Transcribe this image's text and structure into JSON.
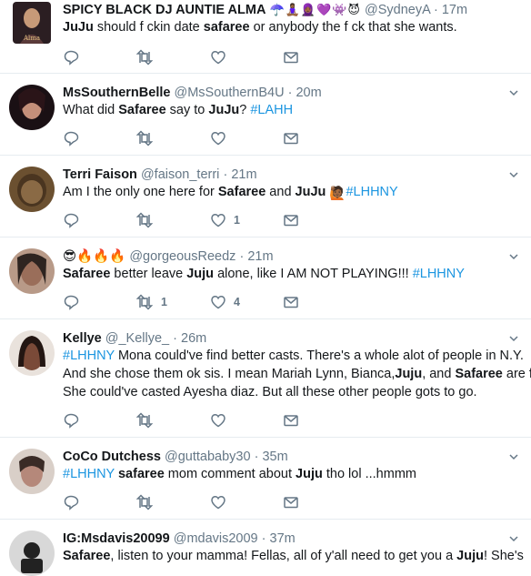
{
  "tweets": [
    {
      "name": "SPICY BLACK DJ AUNTIE ALMA",
      "name_emojis": "☂️🧘🏾‍♀️🧕🏾💜👾😈",
      "handle": "@SydneyA",
      "sep": "·",
      "time": "17m",
      "text": {
        "a": "JuJu",
        "b": " should f  ckin date ",
        "c": "safaree",
        "d": " or anybody the f  ck that she wants."
      },
      "counts": {
        "reply": "",
        "retweet": "",
        "like": ""
      },
      "avatar_colors": [
        "#3b2a2a",
        "#d8b48c"
      ]
    },
    {
      "name": "MsSouthernBelle",
      "handle": "@MsSouthernB4U",
      "sep": "·",
      "time": "20m",
      "text": {
        "a": "What did ",
        "b": "Safaree",
        "c": " say to ",
        "d": "JuJu",
        "e": "? ",
        "f": "#LAHH"
      },
      "counts": {
        "reply": "",
        "retweet": "",
        "like": ""
      },
      "avatar_colors": [
        "#1a1014",
        "#c48f7a"
      ]
    },
    {
      "name": "Terri Faison",
      "handle": "@faison_terri",
      "sep": "·",
      "time": "21m",
      "text": {
        "a": "Am I the only one here for ",
        "b": "Safaree",
        "c": " and ",
        "d": "JuJu",
        "e": "🙋🏾",
        "f": "#LHHNY"
      },
      "counts": {
        "reply": "",
        "retweet": "",
        "like": "1"
      },
      "avatar_colors": [
        "#4a3520",
        "#8a6a45"
      ]
    },
    {
      "name": "😎🔥🔥🔥",
      "handle": "@gorgeousReedz",
      "sep": "·",
      "time": "21m",
      "text": {
        "a": "Safaree",
        "b": " better leave ",
        "c": "Juju",
        "d": " alone, like I AM NOT PLAYING!!! ",
        "e": "#LHHNY"
      },
      "counts": {
        "reply": "",
        "retweet": "1",
        "like": "4"
      },
      "avatar_colors": [
        "#2e2420",
        "#b08570"
      ]
    },
    {
      "name": "Kellye",
      "handle": "@_Kellye_",
      "sep": "·",
      "time": "26m",
      "lines": [
        {
          "tag": "#LHHNY",
          "rest": " Mona could've find better casts. There's a whole alot of people in N.Y."
        },
        {
          "a": "And she chose them ok sis. I mean Mariah Lynn, Bianca,",
          "b": "Juju",
          "c": ", and ",
          "d": "Safaree",
          "e": " are fine."
        },
        {
          "a": "She could've casted Ayesha diaz. But all these other people gots to go."
        }
      ],
      "counts": {
        "reply": "",
        "retweet": "",
        "like": ""
      },
      "avatar_colors": [
        "#231612",
        "#a36a55"
      ]
    },
    {
      "name": "CoCo Dutchess",
      "handle": "@guttababy30",
      "sep": "·",
      "time": "35m",
      "text": {
        "a": "#LHHNY",
        "b": " ",
        "c": "safaree",
        "d": " mom comment about ",
        "e": "Juju",
        "f": " tho lol ...hmmm"
      },
      "counts": {
        "reply": "",
        "retweet": "",
        "like": ""
      },
      "avatar_colors": [
        "#3a2b26",
        "#c9a08a"
      ]
    },
    {
      "name": "IG:Msdavis20099",
      "handle": "@mdavis2009",
      "sep": "·",
      "time": "37m",
      "text": {
        "a": "Safaree",
        "b": ", listen to your mamma! Fellas, all of y'all need to get you a ",
        "c": "Juju",
        "d": "! She's"
      },
      "avatar_colors": [
        "#d8d8d8",
        "#222222"
      ]
    }
  ]
}
